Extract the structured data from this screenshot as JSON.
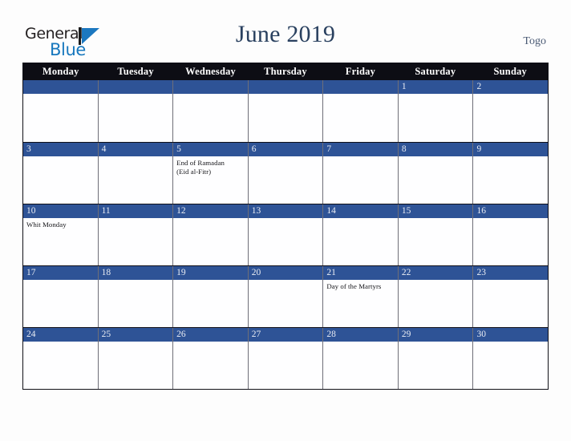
{
  "brand": {
    "name_part1": "General",
    "name_part2": "Blue",
    "logo_icon": "triangle-play-icon"
  },
  "header": {
    "title": "June 2019",
    "country": "Togo"
  },
  "colors": {
    "page_background": "#fdfdfd",
    "header_row_background": "#0d0d14",
    "date_band_blue": "#2e5396",
    "title_navy": "#29405f",
    "brand_blue": "#1878be",
    "cell_background": "#fefeff",
    "grid_border": "#101018"
  },
  "calendar": {
    "day_names": [
      "Monday",
      "Tuesday",
      "Wednesday",
      "Thursday",
      "Friday",
      "Saturday",
      "Sunday"
    ],
    "weeks": [
      [
        {
          "day": "",
          "blank": true,
          "events": []
        },
        {
          "day": "",
          "blank": true,
          "events": []
        },
        {
          "day": "",
          "blank": true,
          "events": []
        },
        {
          "day": "",
          "blank": true,
          "events": []
        },
        {
          "day": "",
          "blank": true,
          "events": []
        },
        {
          "day": "1",
          "blank": false,
          "events": []
        },
        {
          "day": "2",
          "blank": false,
          "events": []
        }
      ],
      [
        {
          "day": "3",
          "blank": false,
          "events": []
        },
        {
          "day": "4",
          "blank": false,
          "events": []
        },
        {
          "day": "5",
          "blank": false,
          "events": [
            "End of Ramadan",
            "(Eid al-Fitr)"
          ]
        },
        {
          "day": "6",
          "blank": false,
          "events": []
        },
        {
          "day": "7",
          "blank": false,
          "events": []
        },
        {
          "day": "8",
          "blank": false,
          "events": []
        },
        {
          "day": "9",
          "blank": false,
          "events": []
        }
      ],
      [
        {
          "day": "10",
          "blank": false,
          "events": [
            "Whit Monday"
          ]
        },
        {
          "day": "11",
          "blank": false,
          "events": []
        },
        {
          "day": "12",
          "blank": false,
          "events": []
        },
        {
          "day": "13",
          "blank": false,
          "events": []
        },
        {
          "day": "14",
          "blank": false,
          "events": []
        },
        {
          "day": "15",
          "blank": false,
          "events": []
        },
        {
          "day": "16",
          "blank": false,
          "events": []
        }
      ],
      [
        {
          "day": "17",
          "blank": false,
          "events": []
        },
        {
          "day": "18",
          "blank": false,
          "events": []
        },
        {
          "day": "19",
          "blank": false,
          "events": []
        },
        {
          "day": "20",
          "blank": false,
          "events": []
        },
        {
          "day": "21",
          "blank": false,
          "events": [
            "Day of the Martyrs"
          ]
        },
        {
          "day": "22",
          "blank": false,
          "events": []
        },
        {
          "day": "23",
          "blank": false,
          "events": []
        }
      ],
      [
        {
          "day": "24",
          "blank": false,
          "events": []
        },
        {
          "day": "25",
          "blank": false,
          "events": []
        },
        {
          "day": "26",
          "blank": false,
          "events": []
        },
        {
          "day": "27",
          "blank": false,
          "events": []
        },
        {
          "day": "28",
          "blank": false,
          "events": []
        },
        {
          "day": "29",
          "blank": false,
          "events": []
        },
        {
          "day": "30",
          "blank": false,
          "events": []
        }
      ]
    ]
  }
}
